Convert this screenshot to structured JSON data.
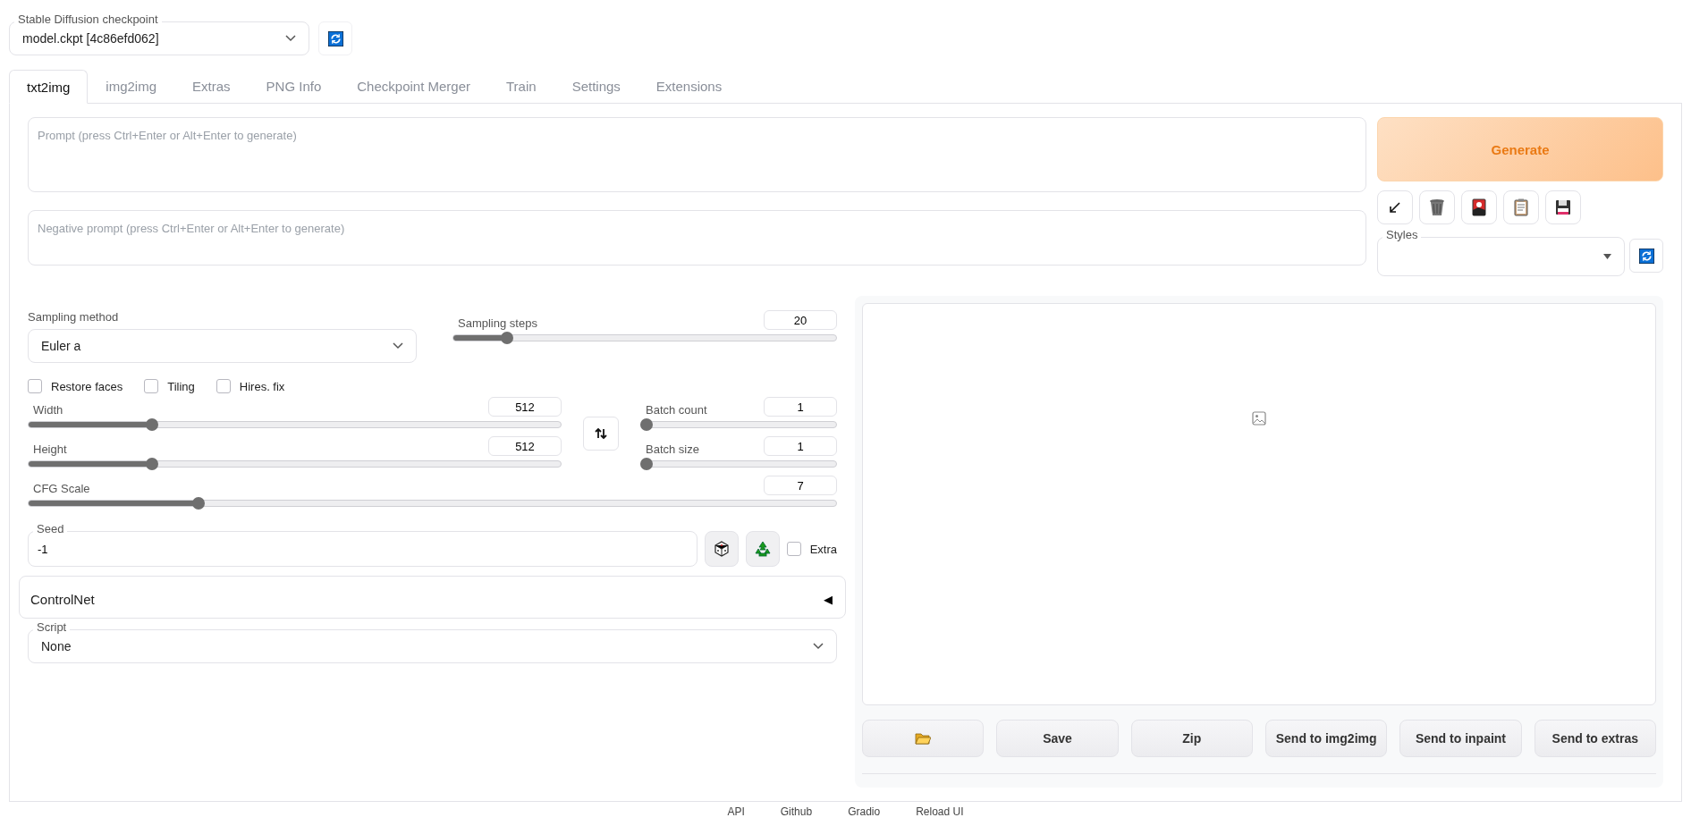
{
  "checkpoint": {
    "label": "Stable Diffusion checkpoint",
    "value": "model.ckpt [4c86efd062]"
  },
  "tabs": [
    {
      "label": "txt2img",
      "selected": true
    },
    {
      "label": "img2img",
      "selected": false
    },
    {
      "label": "Extras",
      "selected": false
    },
    {
      "label": "PNG Info",
      "selected": false
    },
    {
      "label": "Checkpoint Merger",
      "selected": false
    },
    {
      "label": "Train",
      "selected": false
    },
    {
      "label": "Settings",
      "selected": false
    },
    {
      "label": "Extensions",
      "selected": false
    }
  ],
  "prompt": {
    "placeholder": "Prompt (press Ctrl+Enter or Alt+Enter to generate)"
  },
  "negative_prompt": {
    "placeholder": "Negative prompt (press Ctrl+Enter or Alt+Enter to generate)"
  },
  "generate_button": "Generate",
  "styles": {
    "label": "Styles"
  },
  "sampling_method": {
    "label": "Sampling method",
    "value": "Euler a"
  },
  "sampling_steps": {
    "label": "Sampling steps",
    "value": "20",
    "level": 0.13
  },
  "checkboxes": [
    {
      "label": "Restore faces",
      "checked": false
    },
    {
      "label": "Tiling",
      "checked": false
    },
    {
      "label": "Hires. fix",
      "checked": false
    }
  ],
  "size_sliders": [
    {
      "label": "Width",
      "value": "512",
      "level": 0.226
    },
    {
      "label": "Height",
      "value": "512",
      "level": 0.226
    }
  ],
  "batch_sliders": [
    {
      "label": "Batch count",
      "value": "1",
      "level": 0
    },
    {
      "label": "Batch size",
      "value": "1",
      "level": 0
    }
  ],
  "cfg_scale": {
    "label": "CFG Scale",
    "value": "7",
    "level": 0.207
  },
  "seed": {
    "label": "Seed",
    "value": "-1"
  },
  "extra": {
    "label": "Extra",
    "checked": false
  },
  "controlnet": {
    "title": "ControlNet",
    "arrow": "◀"
  },
  "script": {
    "label": "Script",
    "value": "None"
  },
  "gallery_buttons": [
    {
      "kind": "folder"
    },
    {
      "kind": "text",
      "label": "Save"
    },
    {
      "kind": "text",
      "label": "Zip"
    },
    {
      "kind": "text",
      "label": "Send to img2img"
    },
    {
      "kind": "text",
      "label": "Send to inpaint"
    },
    {
      "kind": "text",
      "label": "Send to extras"
    }
  ],
  "footer_links": [
    "API",
    "Github",
    "Gradio",
    "Reload UI"
  ]
}
